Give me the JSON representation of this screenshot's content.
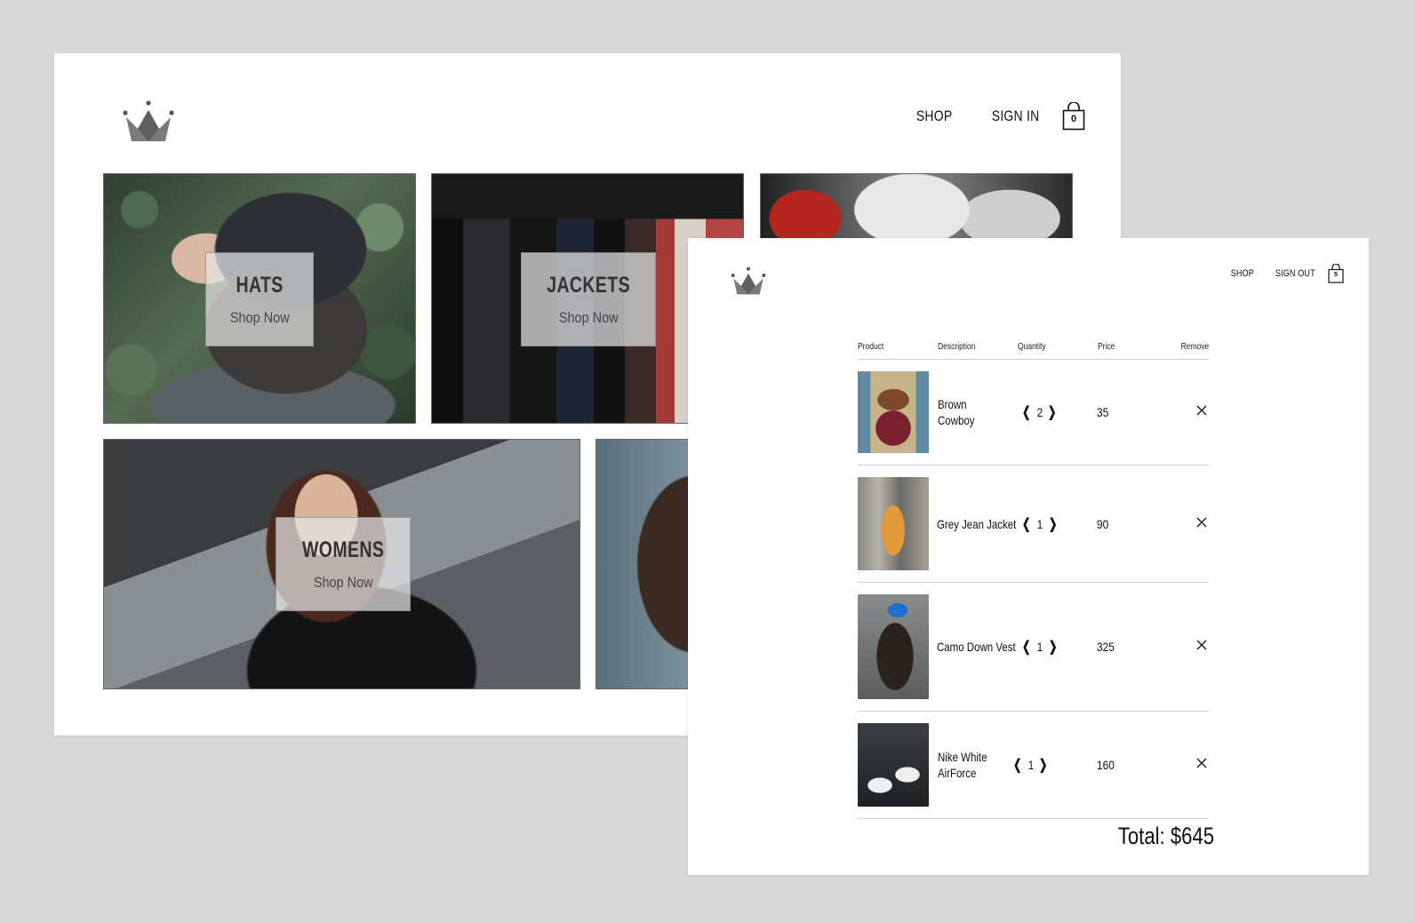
{
  "home": {
    "nav": {
      "shop": "SHOP",
      "sign_in": "SIGN IN",
      "cart_count": "0"
    },
    "categories": [
      {
        "title": "HATS",
        "cta": "Shop Now"
      },
      {
        "title": "JACKETS",
        "cta": "Shop Now"
      },
      {
        "title": "WOMENS",
        "cta": "Shop Now"
      }
    ]
  },
  "checkout": {
    "nav": {
      "shop": "SHOP",
      "sign_out": "SIGN OUT",
      "cart_count": "5"
    },
    "columns": {
      "product": "Product",
      "description": "Description",
      "quantity": "Quantity",
      "price": "Price",
      "remove": "Remove"
    },
    "items": [
      {
        "name": "Brown Cowboy",
        "quantity": "2",
        "price": "35"
      },
      {
        "name": "Grey Jean Jacket",
        "quantity": "1",
        "price": "90"
      },
      {
        "name": "Camo Down Vest",
        "quantity": "1",
        "price": "325"
      },
      {
        "name": "Nike White AirForce",
        "quantity": "1",
        "price": "160"
      }
    ],
    "total": "Total: $645"
  },
  "colors": {
    "background": "#d9d9d9",
    "logo": "#707070",
    "text": "#111111"
  },
  "icons": {
    "logo": "crown-icon",
    "cart": "shopping-bag-icon",
    "remove": "close-icon",
    "decrease": "chevron-left-icon",
    "increase": "chevron-right-icon"
  }
}
